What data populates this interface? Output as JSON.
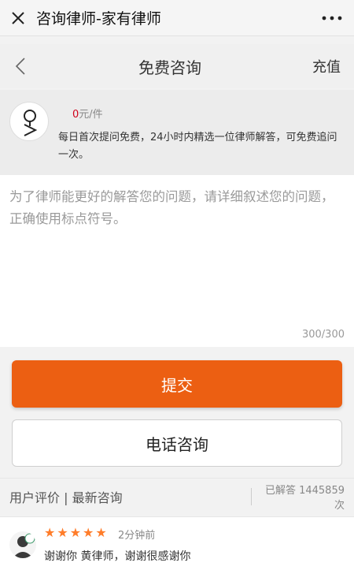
{
  "topbar": {
    "title": "咨询律师-家有律师",
    "close_icon": "close-icon",
    "more_icon": "more-dots-icon"
  },
  "navbar": {
    "title": "免费咨询",
    "recharge": "充值",
    "back_icon": "chevron-left-icon"
  },
  "info": {
    "price_num": "0",
    "price_unit": "元/件",
    "description": "每日首次提问免费，24小时内精选一位律师解答，可免费追问一次。"
  },
  "question": {
    "placeholder": "为了律师能更好的解答您的问题，请详细叙述您的问题，正确使用标点符号。",
    "counter": "300/300"
  },
  "buttons": {
    "submit": "提交",
    "phone": "电话咨询"
  },
  "reviews": {
    "tabs_label": "用户评价 | 最新咨询",
    "answered": "已解答 1445859 次",
    "items": [
      {
        "stars": 5,
        "time": "2分钟前",
        "text": "谢谢你 黄律师，谢谢很感谢你"
      }
    ]
  },
  "colors": {
    "accent": "#ec5f12",
    "price_red": "#d0021b",
    "star": "#ff7d2a"
  }
}
